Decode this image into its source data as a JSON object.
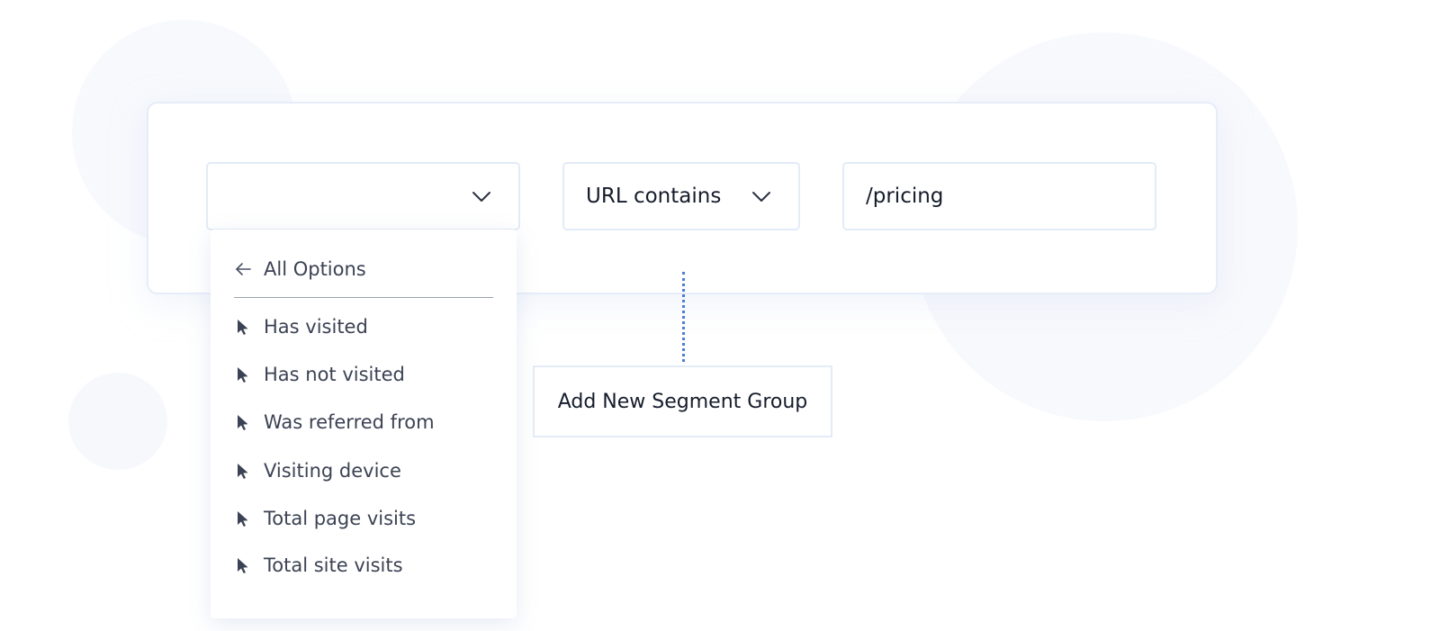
{
  "colors": {
    "text_primary": "#151c2b",
    "text_secondary": "#3b4253",
    "border": "#e3ebf7",
    "connector": "#4f7fcf",
    "background_blob": "#f7f9fd"
  },
  "filter_row": {
    "category_select": {
      "value": "",
      "icon": "chevron-down-icon"
    },
    "operator_select": {
      "value": "URL contains",
      "icon": "chevron-down-icon"
    },
    "value_input": {
      "value": "/pricing"
    }
  },
  "dropdown": {
    "back_label": "All Options",
    "back_icon": "arrow-left-icon",
    "options": [
      {
        "label": "Has visited",
        "icon": "cursor-pointer-icon"
      },
      {
        "label": "Has not visited",
        "icon": "cursor-pointer-icon"
      },
      {
        "label": "Was referred from",
        "icon": "cursor-pointer-icon"
      },
      {
        "label": "Visiting device",
        "icon": "cursor-pointer-icon"
      },
      {
        "label": "Total page visits",
        "icon": "cursor-pointer-icon"
      },
      {
        "label": "Total site visits",
        "icon": "cursor-pointer-icon"
      }
    ]
  },
  "add_group_button": {
    "label": "Add New Segment Group"
  }
}
